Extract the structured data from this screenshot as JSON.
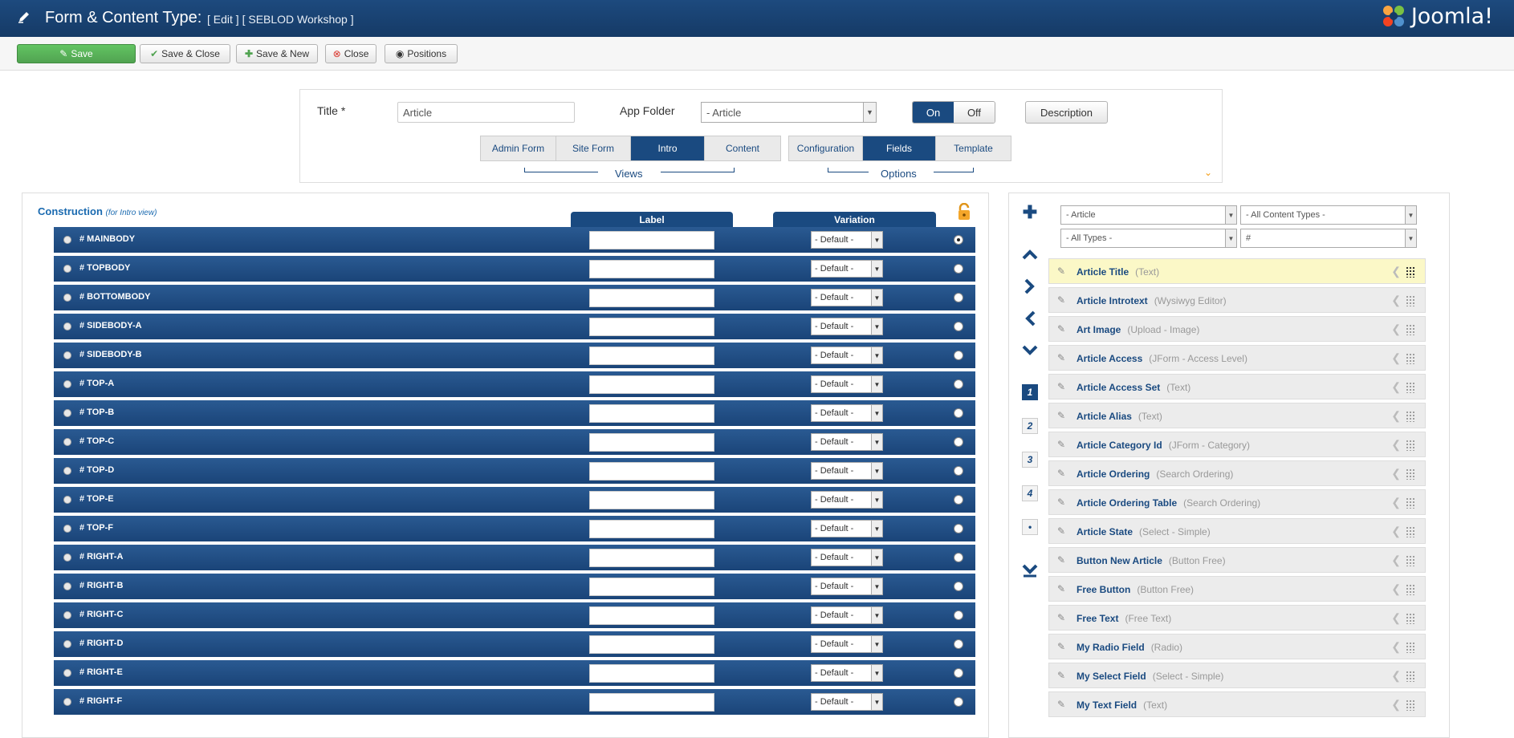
{
  "header": {
    "title": "Form & Content Type:",
    "subtitle": "[ Edit ] [ SEBLOD Workshop ]",
    "logo_text": "Joomla!"
  },
  "toolbar": {
    "save": "Save",
    "save_close": "Save & Close",
    "save_new": "Save & New",
    "close": "Close",
    "positions": "Positions"
  },
  "form": {
    "title_label": "Title",
    "title_required": "*",
    "title_value": "Article",
    "app_folder_label": "App Folder",
    "app_folder_value": "- Article",
    "toggle_on": "On",
    "toggle_off": "Off",
    "description_button": "Description",
    "view_tabs": [
      "Admin Form",
      "Site Form",
      "Intro",
      "Content"
    ],
    "option_tabs": [
      "Configuration",
      "Fields",
      "Template"
    ],
    "views_label": "Views",
    "options_label": "Options"
  },
  "construction": {
    "title": "Construction",
    "note": "(for Intro view)",
    "label_header": "Label",
    "variation_header": "Variation",
    "variation_default": "- Default -",
    "positions": [
      "# MAINBODY",
      "# TOPBODY",
      "# BOTTOMBODY",
      "# SIDEBODY-A",
      "# SIDEBODY-B",
      "# TOP-A",
      "# TOP-B",
      "# TOP-C",
      "# TOP-D",
      "# TOP-E",
      "# TOP-F",
      "# RIGHT-A",
      "# RIGHT-B",
      "# RIGHT-C",
      "# RIGHT-D",
      "# RIGHT-E",
      "# RIGHT-F"
    ]
  },
  "filters": {
    "folder": "- Article",
    "content_types": "- All Content Types -",
    "types": "- All Types -",
    "search": "#"
  },
  "pages": [
    "1",
    "2",
    "3",
    "4",
    "•"
  ],
  "fields": [
    {
      "name": "Article Title",
      "type": "(Text)"
    },
    {
      "name": "Article Introtext",
      "type": "(Wysiwyg Editor)"
    },
    {
      "name": "Art Image",
      "type": "(Upload - Image)"
    },
    {
      "name": "Article Access",
      "type": "(JForm - Access Level)"
    },
    {
      "name": "Article Access Set",
      "type": "(Text)"
    },
    {
      "name": "Article Alias",
      "type": "(Text)"
    },
    {
      "name": "Article Category Id",
      "type": "(JForm - Category)"
    },
    {
      "name": "Article Ordering",
      "type": "(Search Ordering)"
    },
    {
      "name": "Article Ordering Table",
      "type": "(Search Ordering)"
    },
    {
      "name": "Article State",
      "type": "(Select - Simple)"
    },
    {
      "name": "Button New Article",
      "type": "(Button Free)"
    },
    {
      "name": "Free Button",
      "type": "(Button Free)"
    },
    {
      "name": "Free Text",
      "type": "(Free Text)"
    },
    {
      "name": "My Radio Field",
      "type": "(Radio)"
    },
    {
      "name": "My Select Field",
      "type": "(Select - Simple)"
    },
    {
      "name": "My Text Field",
      "type": "(Text)"
    }
  ]
}
